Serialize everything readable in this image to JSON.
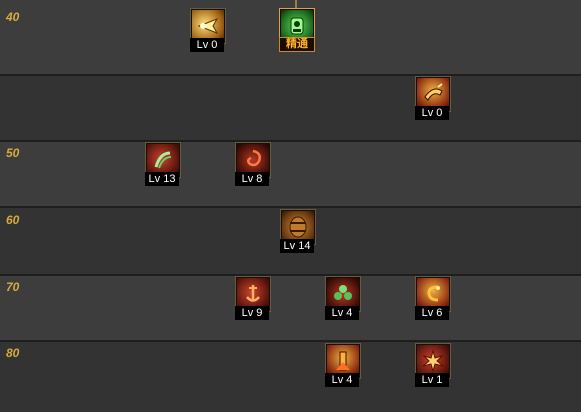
{
  "levels": [
    "40",
    "50",
    "60",
    "70",
    "80"
  ],
  "skills": [
    {
      "id": "skill-40-a",
      "label": "Lv 0",
      "icon": "burst-icon",
      "color": "yellow"
    },
    {
      "id": "skill-40-b",
      "label": "精通",
      "icon": "mastery-crest-icon",
      "color": "green",
      "master": true
    },
    {
      "id": "skill-45-a",
      "label": "Lv 0",
      "icon": "horn-icon",
      "color": "goldred"
    },
    {
      "id": "skill-50-a",
      "label": "Lv 13",
      "icon": "claw-strike-icon",
      "color": "red"
    },
    {
      "id": "skill-50-b",
      "label": "Lv 8",
      "icon": "swirl-icon",
      "color": "darkred"
    },
    {
      "id": "skill-60-a",
      "label": "Lv 14",
      "icon": "barrel-icon",
      "color": "brown"
    },
    {
      "id": "skill-70-a",
      "label": "Lv 9",
      "icon": "anchor-slash-icon",
      "color": "red"
    },
    {
      "id": "skill-70-b",
      "label": "Lv 4",
      "icon": "clover-icon",
      "color": "darkred"
    },
    {
      "id": "skill-70-c",
      "label": "Lv 6",
      "icon": "serpent-icon",
      "color": "goldred"
    },
    {
      "id": "skill-80-a",
      "label": "Lv 4",
      "icon": "pillar-icon",
      "color": "goldred"
    },
    {
      "id": "skill-80-b",
      "label": "Lv 1",
      "icon": "explosion-icon",
      "color": "red"
    }
  ]
}
